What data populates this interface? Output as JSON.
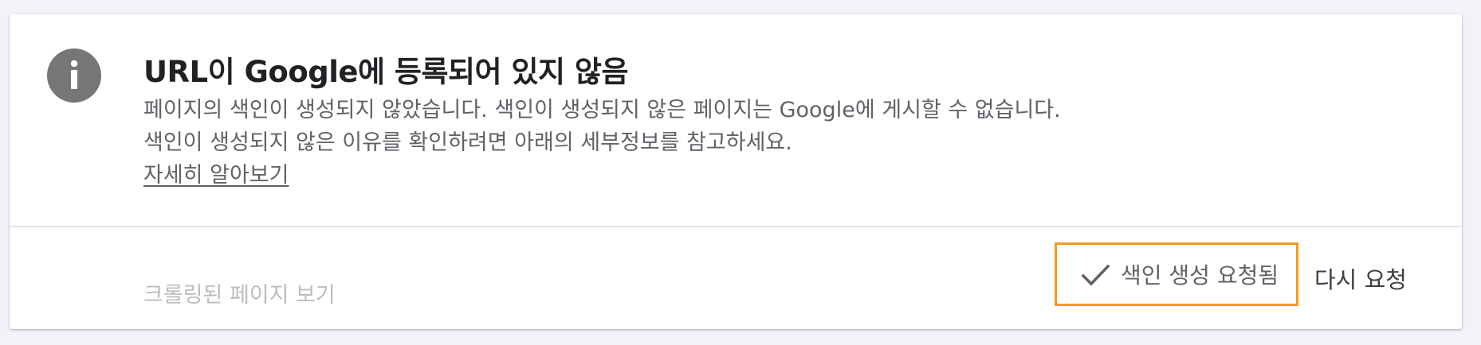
{
  "status": {
    "icon": "info-icon",
    "title": "URL이 Google에 등록되어 있지 않음",
    "description": "페이지의 색인이 생성되지 않았습니다. 색인이 생성되지 않은 페이지는 Google에 게시할 수 없습니다. 색인이 생성되지 않은 이유를 확인하려면 아래의 세부정보를 참고하세요.",
    "learn_more": "자세히 알아보기"
  },
  "actions": {
    "view_crawled_page": "크롤링된 페이지 보기",
    "indexing_requested": "색인 생성 요청됨",
    "request_again": "다시 요청"
  },
  "colors": {
    "highlight_border": "#ee9b1f",
    "icon_gray": "#767676",
    "disabled_text": "#bdbdbd"
  }
}
